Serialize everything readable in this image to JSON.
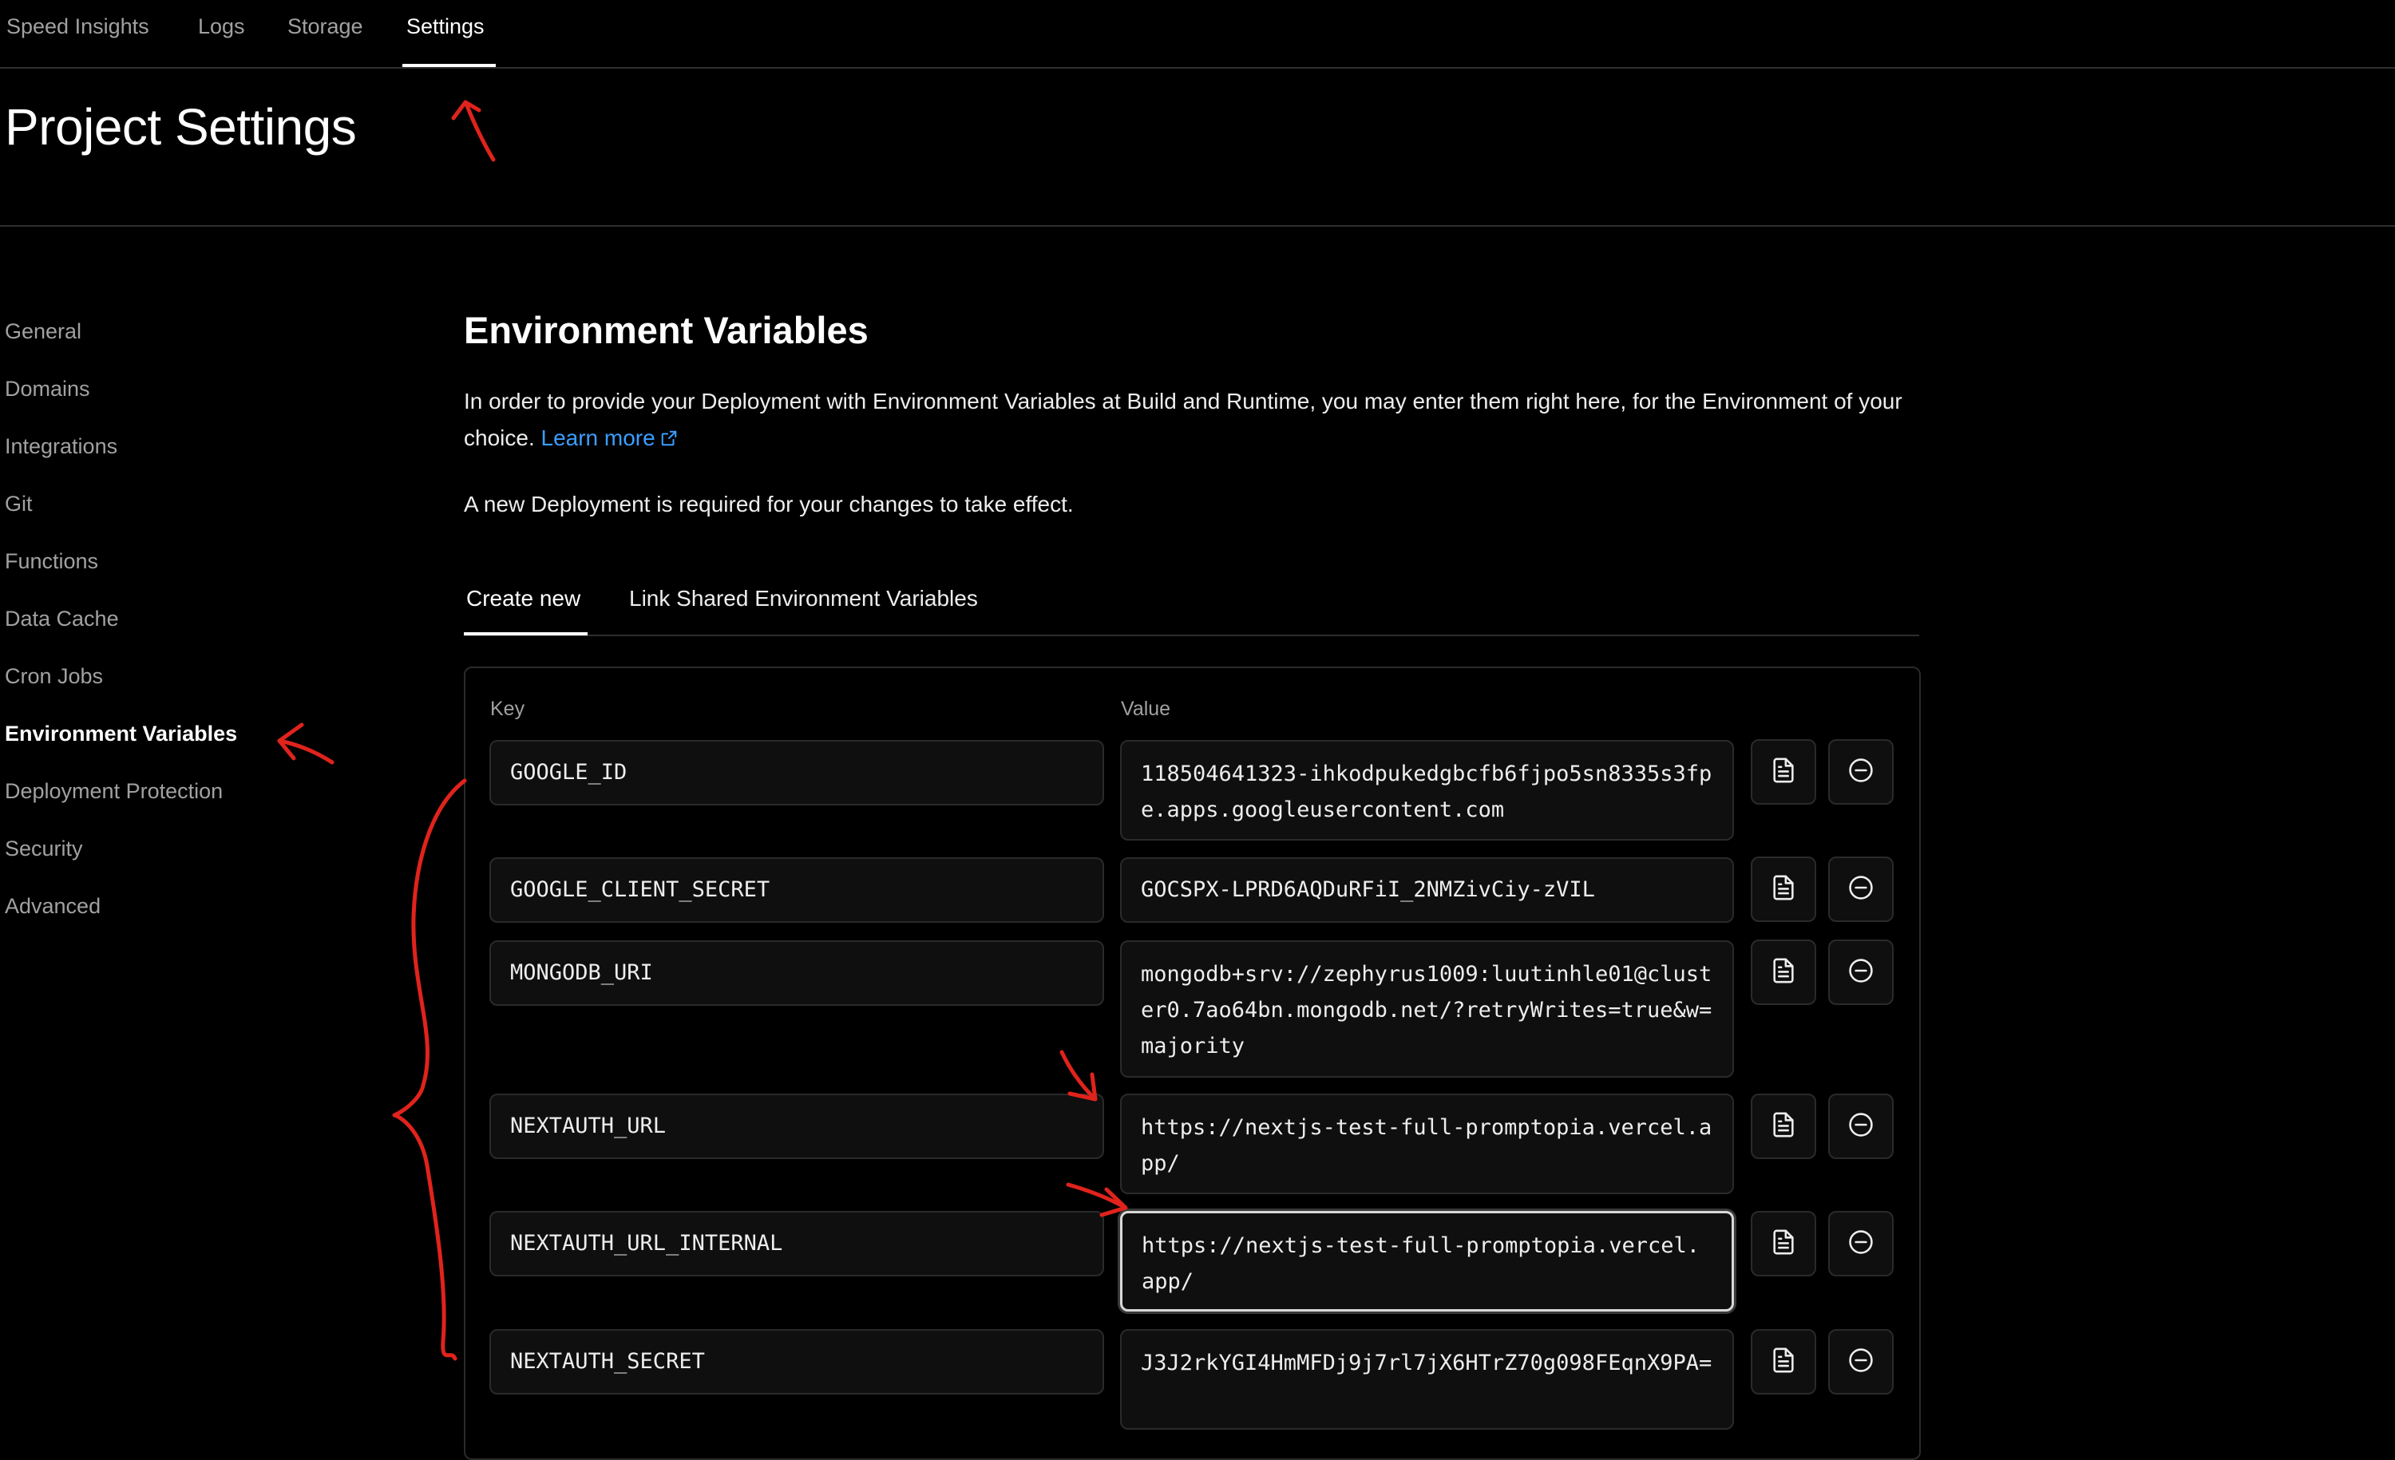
{
  "topnav": {
    "tabs": [
      {
        "label": "Speed Insights"
      },
      {
        "label": "Logs"
      },
      {
        "label": "Storage"
      },
      {
        "label": "Settings",
        "active": true
      }
    ]
  },
  "page": {
    "title": "Project Settings"
  },
  "sidebar": {
    "items": [
      {
        "label": "General"
      },
      {
        "label": "Domains"
      },
      {
        "label": "Integrations"
      },
      {
        "label": "Git"
      },
      {
        "label": "Functions"
      },
      {
        "label": "Data Cache"
      },
      {
        "label": "Cron Jobs"
      },
      {
        "label": "Environment Variables",
        "active": true
      },
      {
        "label": "Deployment Protection"
      },
      {
        "label": "Security"
      },
      {
        "label": "Advanced"
      }
    ]
  },
  "main": {
    "title": "Environment Variables",
    "description": "In order to provide your Deployment with Environment Variables at Build and Runtime, you may enter them right here, for the Environment of your choice.",
    "learn_more": "Learn more",
    "note": "A new Deployment is required for your changes to take effect.",
    "tabs": [
      {
        "label": "Create new",
        "active": true
      },
      {
        "label": "Link Shared Environment Variables"
      }
    ],
    "columns": {
      "key": "Key",
      "value": "Value"
    },
    "rows": [
      {
        "key": "GOOGLE_ID",
        "value": "118504641323-ihkodpukedgbcfb6fjpo5sn8335s3fpe.apps.googleusercontent.com"
      },
      {
        "key": "GOOGLE_CLIENT_SECRET",
        "value": "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"
      },
      {
        "key": "MONGODB_URI",
        "value": "mongodb+srv://zephyrus1009:luutinhle01@cluster0.7ao64bn.mongodb.net/?retryWrites=true&w=majority"
      },
      {
        "key": "NEXTAUTH_URL",
        "value": "https://nextjs-test-full-promptopia.vercel.app/"
      },
      {
        "key": "NEXTAUTH_URL_INTERNAL",
        "value": "https://nextjs-test-full-promptopia.vercel.app/",
        "focused": true
      },
      {
        "key": "NEXTAUTH_SECRET",
        "value": "J3J2rkYGI4HmMFDj9j7rl7jX6HTrZ70g098FEqnX9PA="
      }
    ]
  },
  "icons": {
    "row_action_1": "file-icon",
    "row_action_2": "remove-circle-icon",
    "link": "external-link-icon"
  },
  "colors": {
    "background": "#000000",
    "link": "#3b9eff",
    "annotation": "#e0231c"
  }
}
